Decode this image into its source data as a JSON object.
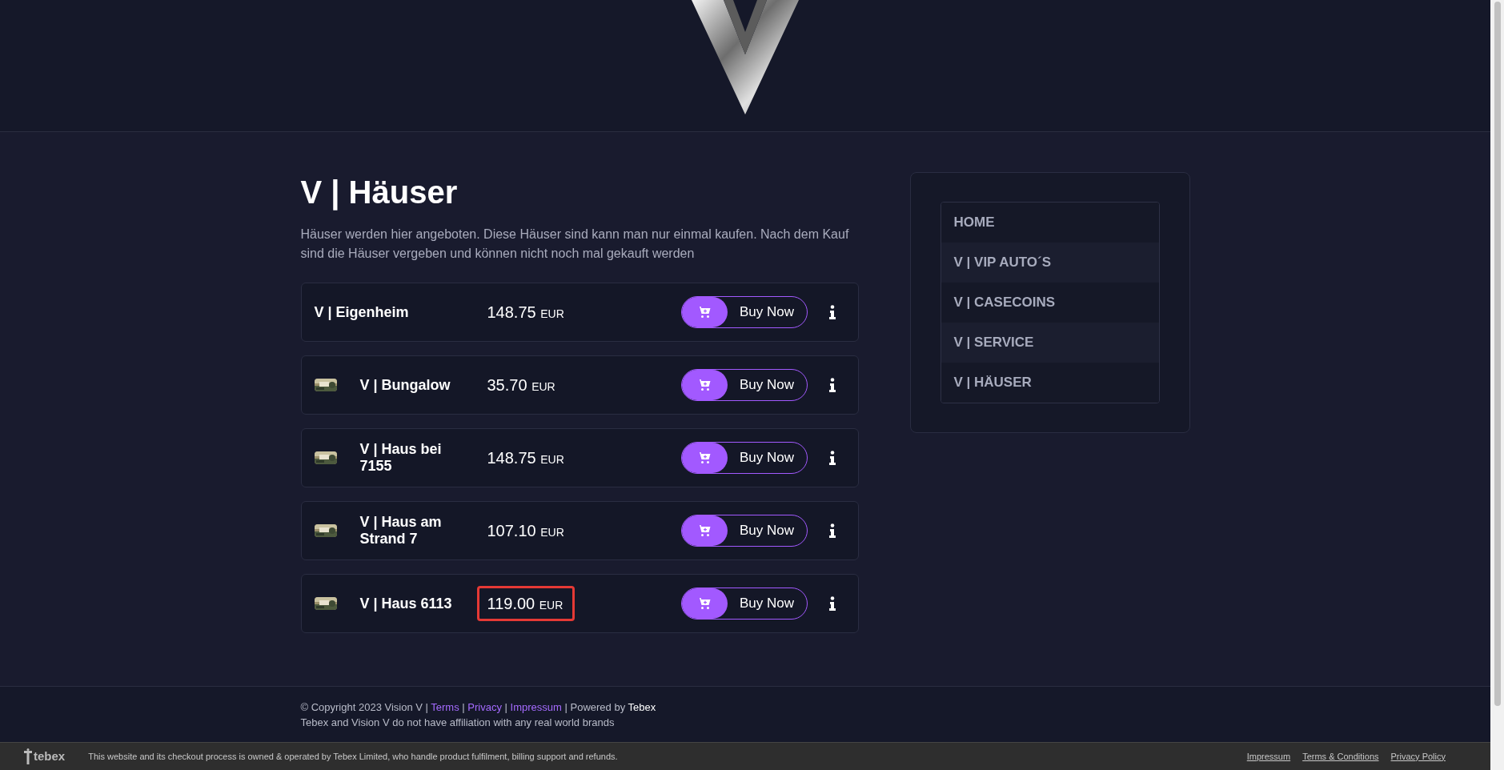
{
  "page_title": "V | Häuser",
  "description": "Häuser werden hier angeboten. Diese Häuser sind kann man nur einmal kaufen. Nach dem Kauf sind die Häuser vergeben und können nicht noch mal gekauft werden",
  "products": [
    {
      "name": "V | Eigenheim",
      "thumbnail": false,
      "price": "148.75",
      "currency": "EUR",
      "button": "Buy Now",
      "highlighted": false
    },
    {
      "name": "V | Bungalow",
      "thumbnail": true,
      "price": "35.70",
      "currency": "EUR",
      "button": "Buy Now",
      "highlighted": false
    },
    {
      "name": "V | Haus bei 7155",
      "thumbnail": true,
      "price": "148.75",
      "currency": "EUR",
      "button": "Buy Now",
      "highlighted": false
    },
    {
      "name": "V | Haus am Strand 7",
      "thumbnail": true,
      "price": "107.10",
      "currency": "EUR",
      "button": "Buy Now",
      "highlighted": false
    },
    {
      "name": "V | Haus 6113",
      "thumbnail": true,
      "price": "119.00",
      "currency": "EUR",
      "button": "Buy Now",
      "highlighted": true
    }
  ],
  "sidebar": {
    "items": [
      "HOME",
      "V | VIP AUTO´S",
      "V | CASECOINS",
      "V | SERVICE",
      "V | HÄUSER"
    ]
  },
  "footer": {
    "line": [
      {
        "kind": "text",
        "text": "© Copyright 2023 Vision V |"
      },
      {
        "kind": "link",
        "text": "Terms"
      },
      {
        "kind": "text",
        "text": "|"
      },
      {
        "kind": "link",
        "text": "Privacy"
      },
      {
        "kind": "text",
        "text": "|"
      },
      {
        "kind": "link",
        "text": "Impressum"
      },
      {
        "kind": "text",
        "text": "| Powered by"
      },
      {
        "kind": "brand",
        "text": "Tebex"
      }
    ],
    "disclaimer": "Tebex and Vision V do not have affiliation with any real world brands"
  },
  "bottom_bar": {
    "logo": "tebex",
    "notice": "This website and its checkout process is owned & operated by Tebex Limited, who handle product fulfilment, billing support and refunds.",
    "links": [
      "Impressum",
      "Terms & Conditions",
      "Privacy Policy"
    ]
  }
}
